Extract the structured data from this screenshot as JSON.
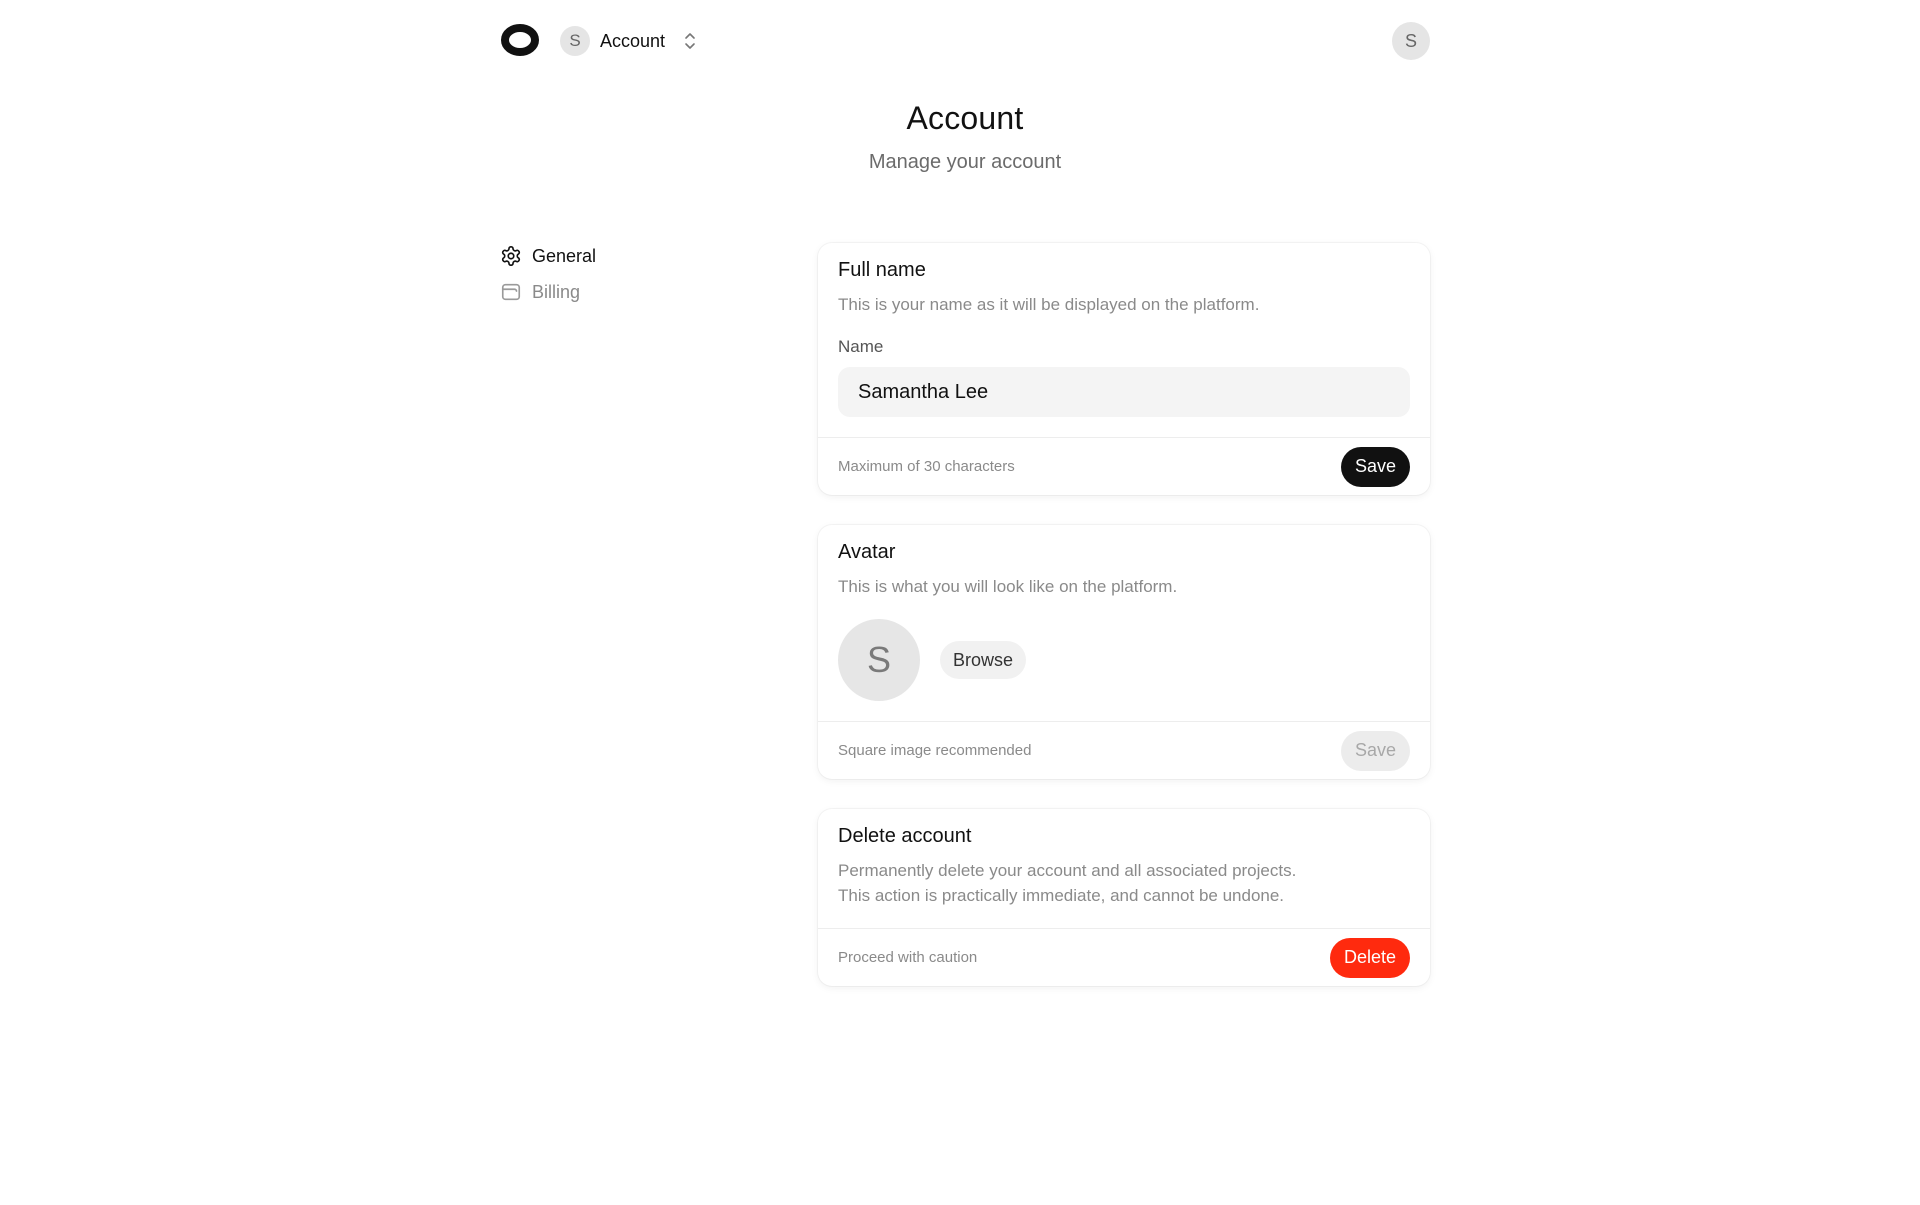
{
  "colors": {
    "accent": "#111111",
    "danger": "#ff2a0e",
    "muted_text": "#8a8a8a",
    "input_bg": "#f4f4f4"
  },
  "header": {
    "logo_icon": "ring-logo-icon",
    "switcher": {
      "avatar_initial": "S",
      "label": "Account",
      "icon": "chevrons-up-down-icon"
    },
    "user_avatar_initial": "S"
  },
  "page": {
    "title": "Account",
    "subtitle": "Manage your account"
  },
  "sidebar": {
    "items": [
      {
        "label": "General",
        "icon": "gear-icon",
        "active": true
      },
      {
        "label": "Billing",
        "icon": "wallet-icon",
        "active": false
      }
    ]
  },
  "full_name_card": {
    "title": "Full name",
    "description": "This is your name as it will be displayed on the platform.",
    "field_label": "Name",
    "value": "Samantha Lee",
    "note": "Maximum of 30 characters",
    "save_label": "Save"
  },
  "avatar_card": {
    "title": "Avatar",
    "description": "This is what you will look like on the platform.",
    "avatar_initial": "S",
    "browse_label": "Browse",
    "note": "Square image recommended",
    "save_label": "Save"
  },
  "delete_card": {
    "title": "Delete account",
    "description_line1": "Permanently delete your account and all associated projects.",
    "description_line2": "This action is practically immediate, and cannot be undone.",
    "note": "Proceed with caution",
    "delete_label": "Delete"
  }
}
